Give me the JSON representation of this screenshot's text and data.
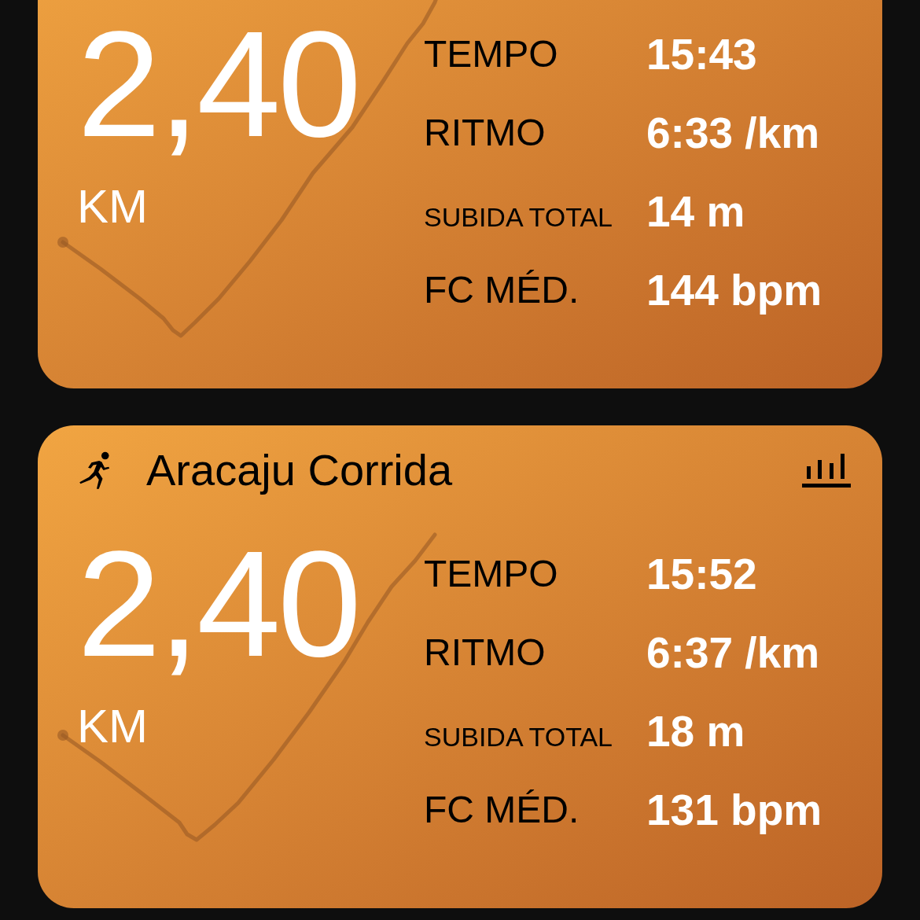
{
  "workouts": [
    {
      "distance": "2,40",
      "unit": "KM",
      "stats": [
        {
          "kind": "regular",
          "label": "TEMPO",
          "value": "15:43"
        },
        {
          "kind": "regular",
          "label": "RITMO",
          "value": "6:33 /km"
        },
        {
          "kind": "compact",
          "label": "SUBIDA TOTAL",
          "value": "14 m"
        },
        {
          "kind": "regular",
          "label": "FC MÉD.",
          "value": "144 bpm"
        }
      ]
    },
    {
      "title": "Aracaju Corrida",
      "distance": "2,40",
      "unit": "KM",
      "stats": [
        {
          "kind": "regular",
          "label": "TEMPO",
          "value": "15:52"
        },
        {
          "kind": "regular",
          "label": "RITMO",
          "value": "6:37 /km"
        },
        {
          "kind": "compact",
          "label": "SUBIDA TOTAL",
          "value": "18 m"
        },
        {
          "kind": "regular",
          "label": "FC MÉD.",
          "value": "131 bpm"
        }
      ]
    }
  ]
}
